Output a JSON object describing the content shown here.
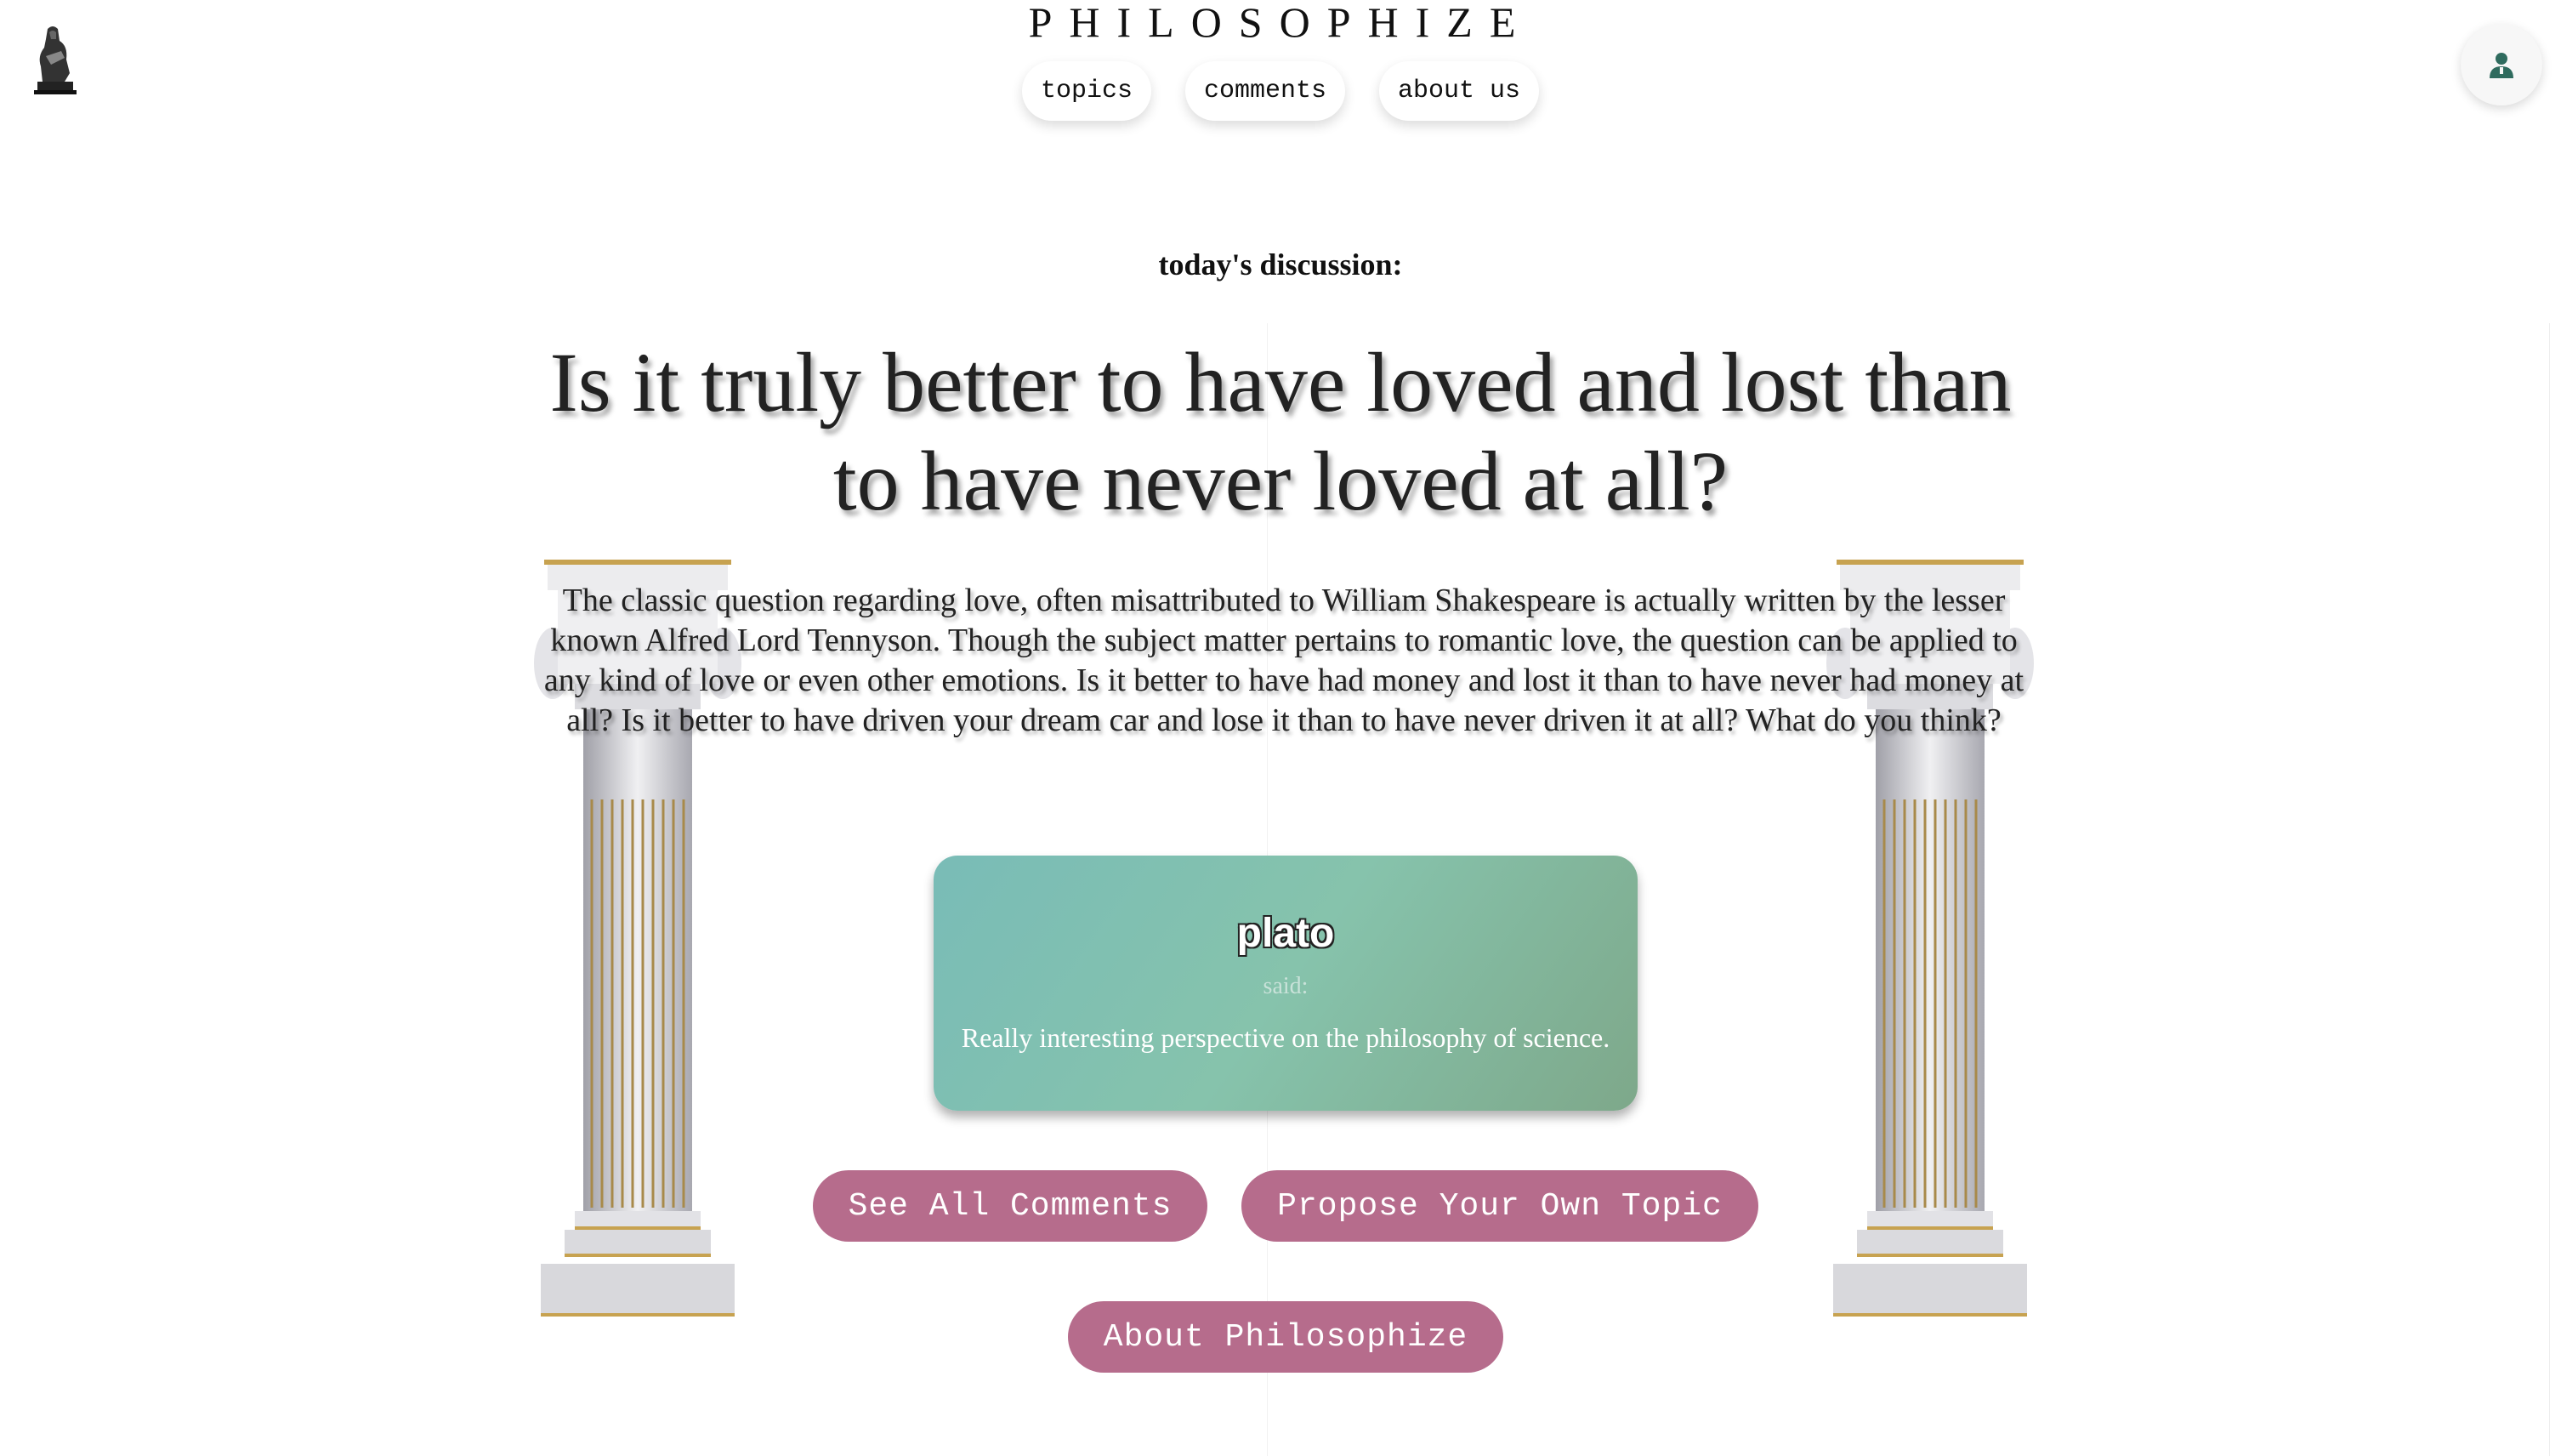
{
  "header": {
    "brand": "PHILOSOPHIZE",
    "nav": [
      {
        "label": "topics"
      },
      {
        "label": "comments"
      },
      {
        "label": "about us"
      }
    ]
  },
  "main": {
    "subtitle": "today's discussion:",
    "headline": "Is it truly better to have loved and lost than to have never loved at all?",
    "description": "The classic question regarding love, often misattributed to William Shakespeare is actually written by the lesser known Alfred Lord Tennyson. Though the subject matter pertains to romantic love, the question can be applied to any kind of love or even other emotions. Is it better to have had money and lost it than to have never had money at all? Is it better to have driven your dream car and lose it than to have never driven it at all? What do you think?",
    "comment": {
      "user": "plato",
      "said": "said:",
      "text": "Really interesting perspective on the philosophy of science."
    },
    "buttons": {
      "see_all": "See All Comments",
      "propose": "Propose Your Own Topic",
      "about": "About Philosophize"
    }
  },
  "colors": {
    "accent_button": "#b66c8c",
    "card_gradient_start": "#79bcb7",
    "card_gradient_end": "#7ea88a",
    "profile_icon": "#2f6b5e"
  },
  "icons": {
    "logo": "thinker-statue-icon",
    "profile": "user-icon",
    "decor": "greek-column"
  }
}
